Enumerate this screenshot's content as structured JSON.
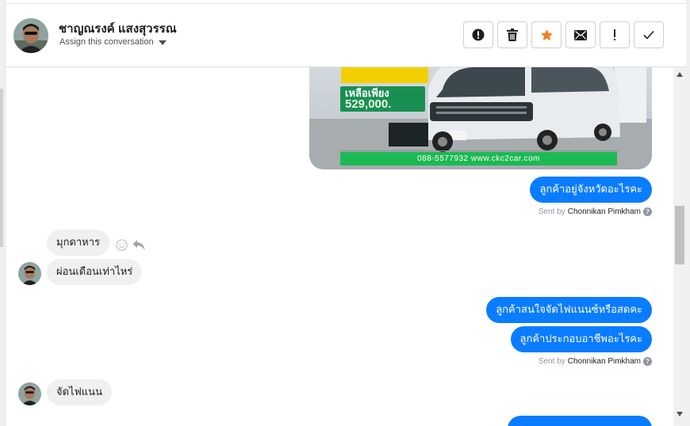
{
  "header": {
    "contact_name": "ชาญณรงค์ แสงสุวรรณ",
    "assign_label": "Assign this conversation"
  },
  "actions": [
    {
      "icon": "alert-circle-icon",
      "label": "!"
    },
    {
      "icon": "trash-icon"
    },
    {
      "icon": "star-icon",
      "color": "#f58020"
    },
    {
      "icon": "envelope-icon"
    },
    {
      "icon": "exclamation-icon",
      "label": "!"
    },
    {
      "icon": "checkmark-icon"
    }
  ],
  "image_ad": {
    "price_label": "เหลือเพียง",
    "price": "529,000.",
    "phone_web": "088-5577932 www.ckc2car.com"
  },
  "messages": [
    {
      "dir": "out",
      "text": "ลูกค้าอยู่จังหวัดอะไรคะ"
    },
    {
      "dir": "in",
      "text": "มุกดาหาร"
    },
    {
      "dir": "in",
      "text": "ผ่อนเดือนเท่าไหร่"
    },
    {
      "dir": "out",
      "text": "ลูกค้าสนใจจัดไฟแนนซ์หรือสดคะ"
    },
    {
      "dir": "out",
      "text": "ลูกค้าประกอบอาชีพอะไรคะ"
    },
    {
      "dir": "in",
      "text": "จัดไฟแนน"
    }
  ],
  "sent_by": {
    "prefix": "Sent by",
    "agent": "Chonnikan Pimkham",
    "help": "?"
  },
  "colors": {
    "outgoing_bubble": "#0a7cff",
    "incoming_bubble": "#f1f0f0",
    "ad_green": "#1db954"
  }
}
